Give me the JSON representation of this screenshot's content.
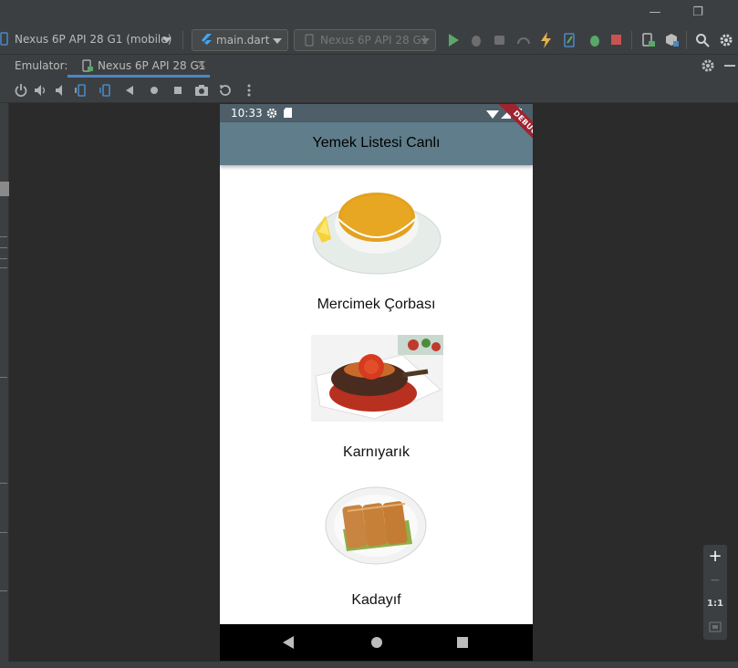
{
  "window": {
    "minimize_glyph": "—",
    "restore_glyph": "❐"
  },
  "toolbar": {
    "device_select": "Nexus 6P API 28 G1 (mobile)",
    "config_select": "main.dart",
    "running_device_select": "Nexus 6P API 28 G1",
    "colors": {
      "run": "#59a869",
      "stop": "#c75450",
      "hot_reload": "#e3b34b",
      "accent": "#4a88c7"
    }
  },
  "emulator": {
    "label": "Emulator:",
    "tab_label": "Nexus 6P API 28 G1",
    "tab_close": "×"
  },
  "phone": {
    "time": "10:33",
    "debug_banner": "DEBUG",
    "app_title": "Yemek Listesi Canlı",
    "foods": [
      {
        "name": "Mercimek Çorbası",
        "icon": "lentil-soup-image"
      },
      {
        "name": "Karnıyarık",
        "icon": "karniyarik-image"
      },
      {
        "name": "Kadayıf",
        "icon": "kadayif-image"
      }
    ],
    "colors": {
      "app_bar": "#5f7d8b",
      "status_bar": "#4e5f6a",
      "nav_bar": "#000000"
    }
  },
  "zoom": {
    "zoom_in": "+",
    "zoom_out": "−",
    "actual_size": "1:1"
  }
}
